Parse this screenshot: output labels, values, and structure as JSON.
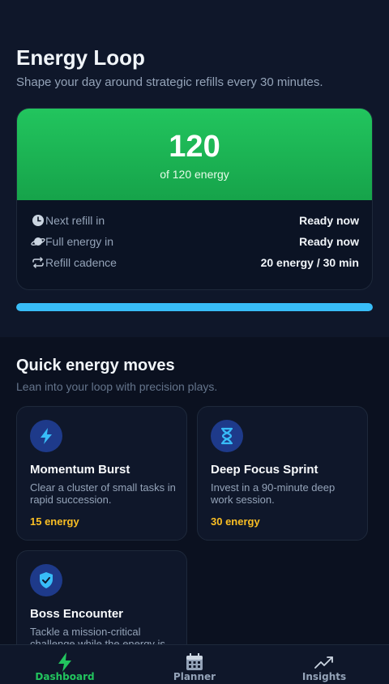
{
  "header": {
    "title": "Energy Loop",
    "subtitle": "Shape your day around strategic refills every 30 minutes."
  },
  "energy": {
    "current": "120",
    "caption": "of 120 energy",
    "progress_fraction": 1.0,
    "stats": [
      {
        "icon": "clock-icon",
        "label": "Next refill in",
        "value": "Ready now"
      },
      {
        "icon": "planet-icon",
        "label": "Full energy in",
        "value": "Ready now"
      },
      {
        "icon": "repeat-icon",
        "label": "Refill cadence",
        "value": "20 energy / 30 min"
      }
    ]
  },
  "moves": {
    "title": "Quick energy moves",
    "subtitle": "Lean into your loop with precision plays.",
    "items": [
      {
        "icon": "lightning-icon",
        "title": "Momentum Burst",
        "description": "Clear a cluster of small tasks in rapid succession.",
        "cost": "15 energy"
      },
      {
        "icon": "hourglass-icon",
        "title": "Deep Focus Sprint",
        "description": "Invest in a 90-minute deep work session.",
        "cost": "30 energy"
      },
      {
        "icon": "shield-check-icon",
        "title": "Boss Encounter",
        "description": "Tackle a mission-critical challenge while the energy is",
        "cost": ""
      }
    ]
  },
  "nav": {
    "items": [
      {
        "icon": "lightning-icon",
        "label": "Dashboard",
        "active": true
      },
      {
        "icon": "calendar-icon",
        "label": "Planner",
        "active": false
      },
      {
        "icon": "trending-up-icon",
        "label": "Insights",
        "active": false
      }
    ]
  },
  "colors": {
    "accent_green": "#22c55e",
    "progress_blue": "#38bdf8",
    "cost_amber": "#fbbf24",
    "background": "#0b1120"
  }
}
